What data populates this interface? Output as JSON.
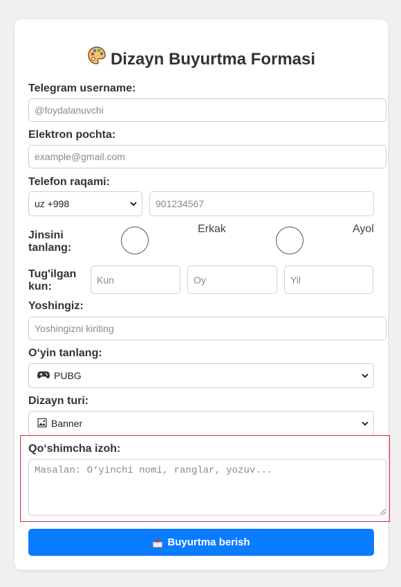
{
  "form": {
    "title": "Dizayn Buyurtma Formasi",
    "title_icon": "palette-icon",
    "telegram": {
      "label": "Telegram username:",
      "placeholder": "@foydalanuvchi",
      "value": ""
    },
    "email": {
      "label": "Elektron pochta:",
      "placeholder": "example@gmail.com",
      "value": ""
    },
    "phone": {
      "label": "Telefon raqami:",
      "country_code": "uz +998",
      "placeholder": "901234567",
      "value": ""
    },
    "gender": {
      "label": "Jinsini tanlang:",
      "options": [
        "Erkak",
        "Ayol"
      ],
      "selected": null
    },
    "birthday": {
      "label": "Tug'ilgan kun:",
      "day_placeholder": "Kun",
      "month_placeholder": "Oy",
      "year_placeholder": "Yil"
    },
    "age": {
      "label": "Yoshingiz:",
      "placeholder": "Yoshingizni kiriting",
      "value": ""
    },
    "game": {
      "label": "O‘yin tanlang:",
      "selected": "PUBG",
      "icon": "gamepad-icon"
    },
    "design_type": {
      "label": "Dizayn turi:",
      "selected": "Banner",
      "icon": "banner-icon"
    },
    "comment": {
      "label": "Qo‘shimcha izoh:",
      "placeholder": "Masalan: O‘yinchi nomi, ranglar, yozuv...",
      "value": ""
    },
    "submit_label": "Buyurtma berish",
    "submit_icon": "inbox-tray-icon"
  },
  "colors": {
    "accent": "#0a7cff",
    "highlight": "#e0262e",
    "background": "#f0f0f0"
  }
}
